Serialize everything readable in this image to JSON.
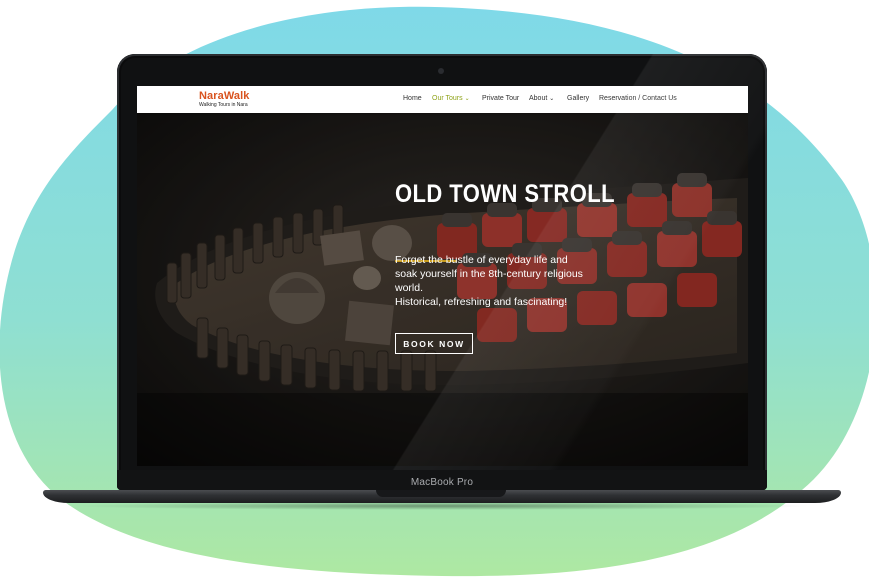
{
  "device": {
    "model_label": "MacBook Pro"
  },
  "site": {
    "logo": {
      "title": "NaraWalk",
      "subtitle": "Walking Tours in Nara"
    },
    "nav": [
      {
        "label": "Home",
        "active": false,
        "dropdown": false
      },
      {
        "label": "Our Tours",
        "active": true,
        "dropdown": true
      },
      {
        "label": "Private Tour",
        "active": false,
        "dropdown": false
      },
      {
        "label": "About",
        "active": false,
        "dropdown": true
      },
      {
        "label": "Gallery",
        "active": false,
        "dropdown": false
      },
      {
        "label": "Reservation / Contact Us",
        "active": false,
        "dropdown": false
      }
    ],
    "hero": {
      "title": "OLD TOWN STROLL",
      "lines": [
        "Forget the bustle of everyday life and",
        "soak yourself in the 8th-century religious",
        "world.",
        "Historical, refreshing and fascinating!"
      ],
      "cta_label": "BOOK NOW"
    }
  },
  "colors": {
    "blob_top": "#7fd9e8",
    "blob_bottom": "#a7e6a0",
    "logo": "#d9531e",
    "nav_active": "#8fa31a",
    "accent_rule": "#c79a1c"
  }
}
